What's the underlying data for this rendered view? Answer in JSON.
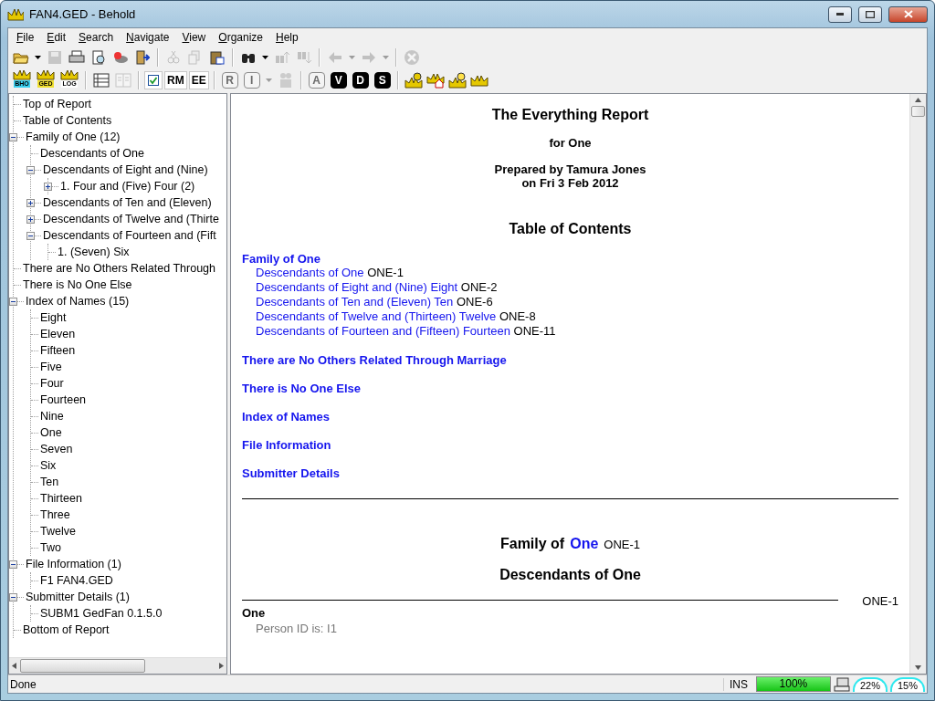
{
  "window": {
    "title": "FAN4.GED - Behold"
  },
  "menu": [
    "File",
    "Edit",
    "Search",
    "Navigate",
    "View",
    "Organize",
    "Help"
  ],
  "toolbar_1": [
    {
      "kind": "icon",
      "disabled": false
    },
    {
      "kind": "dropdown",
      "disabled": false
    },
    {
      "kind": "icon",
      "disabled": true
    },
    {
      "kind": "icon",
      "disabled": false
    },
    {
      "kind": "icon",
      "disabled": false
    },
    {
      "kind": "icon",
      "disabled": false
    },
    {
      "kind": "icon",
      "disabled": false
    },
    {
      "kind": "separator"
    },
    {
      "kind": "icon",
      "disabled": true
    },
    {
      "kind": "icon",
      "disabled": true
    },
    {
      "kind": "icon",
      "disabled": false
    },
    {
      "kind": "separator"
    },
    {
      "kind": "icon",
      "disabled": false
    },
    {
      "kind": "dropdown",
      "disabled": false
    },
    {
      "kind": "icon",
      "disabled": true
    },
    {
      "kind": "icon",
      "disabled": true
    },
    {
      "kind": "separator"
    },
    {
      "kind": "icon",
      "disabled": true
    },
    {
      "kind": "dropdown",
      "disabled": true
    },
    {
      "kind": "icon",
      "disabled": true
    },
    {
      "kind": "dropdown",
      "disabled": true
    },
    {
      "kind": "separator"
    },
    {
      "kind": "icon",
      "disabled": true
    }
  ],
  "toolbar_2": [
    {
      "kind": "icon",
      "label": "BHO"
    },
    {
      "kind": "icon",
      "label": "GED"
    },
    {
      "kind": "icon",
      "label": "LOG"
    },
    {
      "kind": "separator"
    },
    {
      "kind": "icon",
      "disabled": false
    },
    {
      "kind": "icon",
      "disabled": true
    },
    {
      "kind": "separator"
    },
    {
      "kind": "check",
      "checked": true
    },
    {
      "kind": "letter",
      "disabled": false,
      "label": "RM"
    },
    {
      "kind": "letter",
      "disabled": false,
      "label": "EE"
    },
    {
      "kind": "separator"
    },
    {
      "kind": "badge",
      "disabled": true,
      "label": "R"
    },
    {
      "kind": "badge",
      "disabled": true,
      "label": "I"
    },
    {
      "kind": "dropdown",
      "disabled": true
    },
    {
      "kind": "icon",
      "disabled": true
    },
    {
      "kind": "separator"
    },
    {
      "kind": "badge",
      "disabled": true,
      "label": "A"
    },
    {
      "kind": "badge",
      "disabled": false,
      "label": "V"
    },
    {
      "kind": "badge",
      "disabled": false,
      "label": "D"
    },
    {
      "kind": "badge",
      "disabled": false,
      "label": "S"
    },
    {
      "kind": "separator"
    },
    {
      "kind": "icon",
      "disabled": false
    },
    {
      "kind": "icon",
      "disabled": false
    },
    {
      "kind": "icon",
      "disabled": false
    },
    {
      "kind": "icon",
      "disabled": false
    }
  ],
  "tree": [
    {
      "label": "Top of Report"
    },
    {
      "label": "Table of Contents"
    },
    {
      "label": "Family of One (12)",
      "expanded": true,
      "children": [
        {
          "label": "Descendants of One"
        },
        {
          "label": "Descendants of Eight and (Nine)",
          "expanded": true,
          "children": [
            {
              "label": "1. Four and (Five) Four (2)",
              "expanded": false
            }
          ]
        },
        {
          "label": "Descendants of Ten and (Eleven)",
          "expanded": false
        },
        {
          "label": "Descendants of Twelve and (Thirte",
          "expanded": false
        },
        {
          "label": "Descendants of Fourteen and (Fift",
          "expanded": true,
          "children": [
            {
              "label": "1. (Seven) Six"
            }
          ]
        }
      ]
    },
    {
      "label": "There are No Others Related Through"
    },
    {
      "label": "There is No One Else"
    },
    {
      "label": "Index of Names (15)",
      "expanded": true,
      "children": [
        {
          "label": "Eight"
        },
        {
          "label": "Eleven"
        },
        {
          "label": "Fifteen"
        },
        {
          "label": "Five"
        },
        {
          "label": "Four"
        },
        {
          "label": "Fourteen"
        },
        {
          "label": "Nine"
        },
        {
          "label": "One"
        },
        {
          "label": "Seven"
        },
        {
          "label": "Six"
        },
        {
          "label": "Ten"
        },
        {
          "label": "Thirteen"
        },
        {
          "label": "Three"
        },
        {
          "label": "Twelve"
        },
        {
          "label": "Two"
        }
      ]
    },
    {
      "label": "File Information (1)",
      "expanded": true,
      "children": [
        {
          "label": "F1 FAN4.GED"
        }
      ]
    },
    {
      "label": "Submitter Details (1)",
      "expanded": true,
      "children": [
        {
          "label": "SUBM1 GedFan 0.1.5.0"
        }
      ]
    },
    {
      "label": "Bottom of Report"
    }
  ],
  "report": {
    "title": "The Everything Report",
    "subtitle": "for One",
    "prepared": [
      "Prepared by Tamura Jones",
      "on Fri 3 Feb 2012"
    ],
    "toc_title": "Table of Contents",
    "toc": [
      {
        "link": "Family of One",
        "children": [
          {
            "link": "Descendants of One",
            "ref": "ONE-1"
          },
          {
            "link": "Descendants of Eight and (Nine) Eight",
            "ref": "ONE-2"
          },
          {
            "link": "Descendants of Ten and (Eleven) Ten",
            "ref": "ONE-6"
          },
          {
            "link": "Descendants of Twelve and (Thirteen) Twelve",
            "ref": "ONE-8"
          },
          {
            "link": "Descendants of Fourteen and (Fifteen) Fourteen",
            "ref": "ONE-11"
          }
        ]
      },
      {
        "link": "There are No Others Related Through Marriage"
      },
      {
        "link": "There is No One Else"
      },
      {
        "link": "Index of Names"
      },
      {
        "link": "File Information"
      },
      {
        "link": "Submitter Details"
      }
    ],
    "section": {
      "heading": "Family of",
      "heading_link": "One",
      "heading_ref": "ONE-1",
      "subheading": "Descendants of One",
      "rule_ref": "ONE-1",
      "person": "One",
      "detail": "Person ID is: I1"
    }
  },
  "status_bar": {
    "message": "Done",
    "mode": "INS",
    "progress": {
      "level": 1,
      "reading": "100%"
    },
    "gauges": [
      "22%",
      "15%"
    ]
  }
}
